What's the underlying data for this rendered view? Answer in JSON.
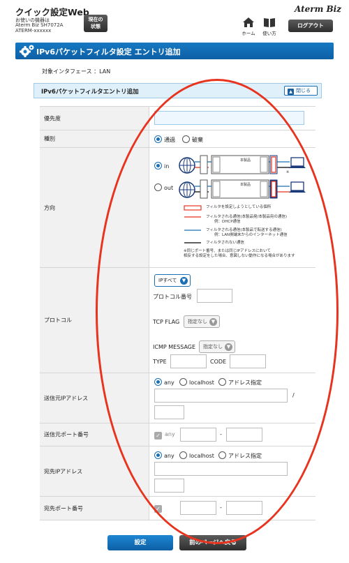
{
  "header": {
    "app_title": "クイック設定Web",
    "device_line1": "お使いの機器は",
    "device_line2": "Aterm Biz SH7072A",
    "device_line3": "ATERM-xxxxxx",
    "status_button_line1": "現在の",
    "status_button_line2": "状態",
    "home_label": "ホーム",
    "usage_label": "使い方",
    "brand_logo": "Aterm Biz",
    "logout_label": "ログアウト"
  },
  "page": {
    "title": "IPv6パケットフィルタ設定 エントリ追加",
    "interface_label": "対象インタフェース ：LAN"
  },
  "section": {
    "title": "IPv6パケットフィルタエントリ追加",
    "close_label": "閉じる"
  },
  "form": {
    "priority": {
      "label": "優先度",
      "value": ""
    },
    "type": {
      "label": "種別",
      "options": [
        "通過",
        "破棄"
      ],
      "selected": "通過"
    },
    "direction": {
      "label": "方向",
      "options": [
        "in",
        "out"
      ],
      "selected": "in",
      "diagram": {
        "device_label": "本製品",
        "legend": [
          "フィルタを設定しようとしている個所",
          "フィルタされる通信(本製品発/本製品宛の通信)",
          "例：DHCP通信",
          "フィルタされる通信(本製品で転送する通信)",
          "例：LAN側端末からのインターネット通信",
          "フィルタされない通信"
        ],
        "note_line1": "※同じポート番号、または同じIPアドレスにおいて",
        "note_line2": "相反する設定をした場合、意図しない動作になる場合があります"
      }
    },
    "protocol": {
      "label": "プロトコル",
      "protocol_select": "IPすべて",
      "protocol_number_label": "プロトコル番号",
      "protocol_number_value": "",
      "tcp_flag_label": "TCP FLAG",
      "tcp_flag_select": "指定なし",
      "icmp_message_label": "ICMP MESSAGE",
      "icmp_message_select": "指定なし",
      "type_label": "TYPE",
      "type_value": "",
      "code_label": "CODE",
      "code_value": ""
    },
    "src_ip": {
      "label": "送信元IPアドレス",
      "options": [
        "any",
        "localhost",
        "アドレス指定"
      ],
      "selected": "any",
      "slash": "/"
    },
    "src_port": {
      "label": "送信元ポート番号",
      "any_label": "any",
      "dash": "-"
    },
    "dst_ip": {
      "label": "宛先IPアドレス",
      "options": [
        "any",
        "localhost",
        "アドレス指定"
      ],
      "selected": "any"
    },
    "dst_port": {
      "label": "宛先ポート番号",
      "dash": "-"
    }
  },
  "buttons": {
    "set_label": "設定",
    "back_label": "前のページへ戻る"
  },
  "colors": {
    "primary_blue": "#1a6fb5",
    "annotation_red": "#e8331f",
    "dark_button": "#3a3a3a"
  }
}
